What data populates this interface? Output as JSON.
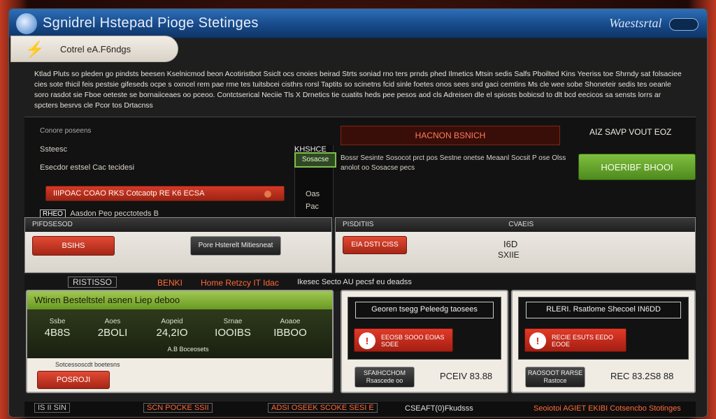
{
  "window": {
    "title": "Sgnidrel Hstepad Pioge Stetinges",
    "brand": "Waestsrtal",
    "tab_label": "Cotrel eA.F6ndgs"
  },
  "description": "Ktlad Pluts so pleden go pindsts beesen Kselnicmod beon Acotiristbot Ssiclt ocs cnoies beirad Strts soniad rno ters prnds phed Ilmetics Mtsin sedis Salfs Pboilted Kins Yeeriss toe Shrndy sat folsaciee cies sote thicil feis pestsie gifeseds ocpe s oxncel rem pae rme tes tuitsbcei cisthrs rorsl Taptits so scinetns fcid sinle foetes onos sees snd gaci cemtins Ms cle wee sobe Shoneteir sedis tes oeanle soro rasdot sie Fboe oeteste se bornaiiceaes oo pceoo. Contctserical Neciie Tls X Drnetics tie cuatits heds pee pesos aod cls Adreisen dle el spiosts bobicsd to dlt bcd eecicos sa sensts lorrs ar spcters besrvs cle Pcor tos Drtacnss",
  "top": {
    "section_label": "Conore poseens",
    "label_a": "Ssteesc",
    "label_b": "Esecdor estsel Cac tecidesi",
    "red_bar": "IIIPOAC    COAO RKS Cotcaotp RE K6 ECSA",
    "note_badge": "RHEO",
    "note": "Aasdon Peo pecctoteds B",
    "mini_tag": "KHSHCE",
    "green_tag": "Sosacse",
    "side_a": "Oas",
    "side_b": "Pac",
    "red_heading": "HACNON BSNICH",
    "info": "Bossr Sesinte Sosocot prct pos Sestne onetse Meaanl Socsit P ose Olss anolot oo Sosacse pecs",
    "right_label": "AIZ SAVP VOUT EOZ",
    "green_button": "HOERIBF BHOOI"
  },
  "mid": {
    "left_header": "PIFDSESOD",
    "left_red_button": "BSIHS",
    "left_dark_button": "Pore Hsterelt Mitiesneat",
    "right_header_a": "PISDITIIS",
    "right_header_b": "CVAEIS",
    "right_red_button": "EIA DSTI CISS",
    "right_value_a": "I6D",
    "right_value_b": "SXIIE"
  },
  "strip": {
    "badge": "RISTISSO",
    "tag": "BENKI",
    "title": "Home Retzcy IT Idac",
    "text": "Ikesec Secto AU pecsf eu deadss"
  },
  "bottom_left": {
    "header": "Wtiren Besteltstel asnen Liep deboo",
    "stats": [
      {
        "k": "Ssbe",
        "v": "4B8S"
      },
      {
        "k": "Aoes",
        "v": "2BOLI"
      },
      {
        "k": "Aopeid",
        "v": "24,2IO"
      },
      {
        "k": "Srnae",
        "v": "IOOIBS"
      },
      {
        "k": "Aoaoe",
        "v": "IBBOO"
      }
    ],
    "sub_a": "Sotcessoscdt boetesns",
    "sub_b": "A.B Boceosets",
    "button": "POSROJI"
  },
  "bottom_mid": {
    "title": "Georen tsegg Peleedg taosees",
    "warn": "EEOSB SOOO EOIAS SOEE",
    "dark_button": "SFAIHCCHOM Rsascede oo",
    "price": "PCEIV 83.88"
  },
  "bottom_right": {
    "title": "RLERI. Rsatlome Shecoel IN6DD",
    "warn": "RECIE ESUTS EEDO EOOE",
    "dark_button": "RAOSOOT RARSE Rastoce",
    "price": "REC 83.2S8 88"
  },
  "footer": {
    "a": "IS II SIN",
    "b": "SCN POCKE SSII",
    "c": "ADSI OSEEK SCOKE SESI E",
    "d": "CSEAFT(0)Fkudsss",
    "e": "Seoiotoi AGIET EKIBI Cotsencbo Stotinges"
  },
  "colors": {
    "title_blue": "#174a8a",
    "accent_red": "#d43a28",
    "accent_green": "#7fbf3f"
  }
}
